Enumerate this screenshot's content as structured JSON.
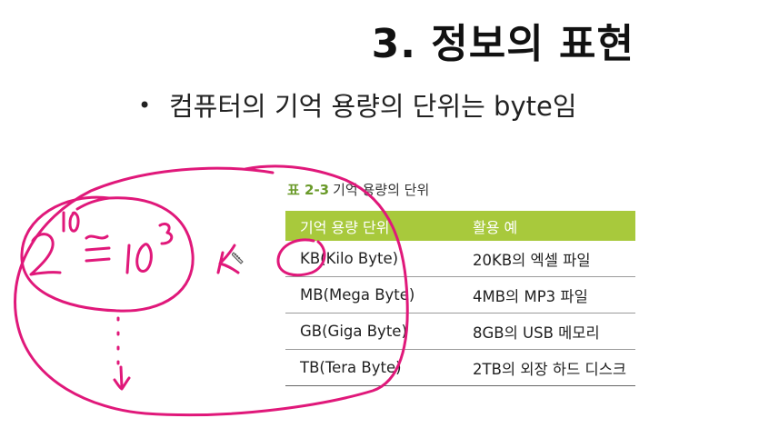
{
  "slide": {
    "title": "3. 정보의 표현",
    "bullet_symbol": "•",
    "bullet_text": "컴퓨터의 기억 용량의 단위는 byte임"
  },
  "table": {
    "caption_number": "표 2-3",
    "caption_text": "기억 용량의 단위",
    "headers": [
      "기억 용량 단위",
      "활용 예"
    ],
    "rows": [
      [
        "KB(Kilo Byte)",
        "20KB의 엑셀 파일"
      ],
      [
        "MB(Mega Byte)",
        "4MB의 MP3 파일"
      ],
      [
        "GB(Giga Byte)",
        "8GB의 USB 메모리"
      ],
      [
        "TB(Tera Byte)",
        "2TB의 외장 하드 디스크"
      ]
    ]
  },
  "annotations": {
    "ink_color": "#e0187a",
    "handwriting": [
      "2",
      "10",
      "≅",
      "10",
      "3",
      "K"
    ]
  }
}
